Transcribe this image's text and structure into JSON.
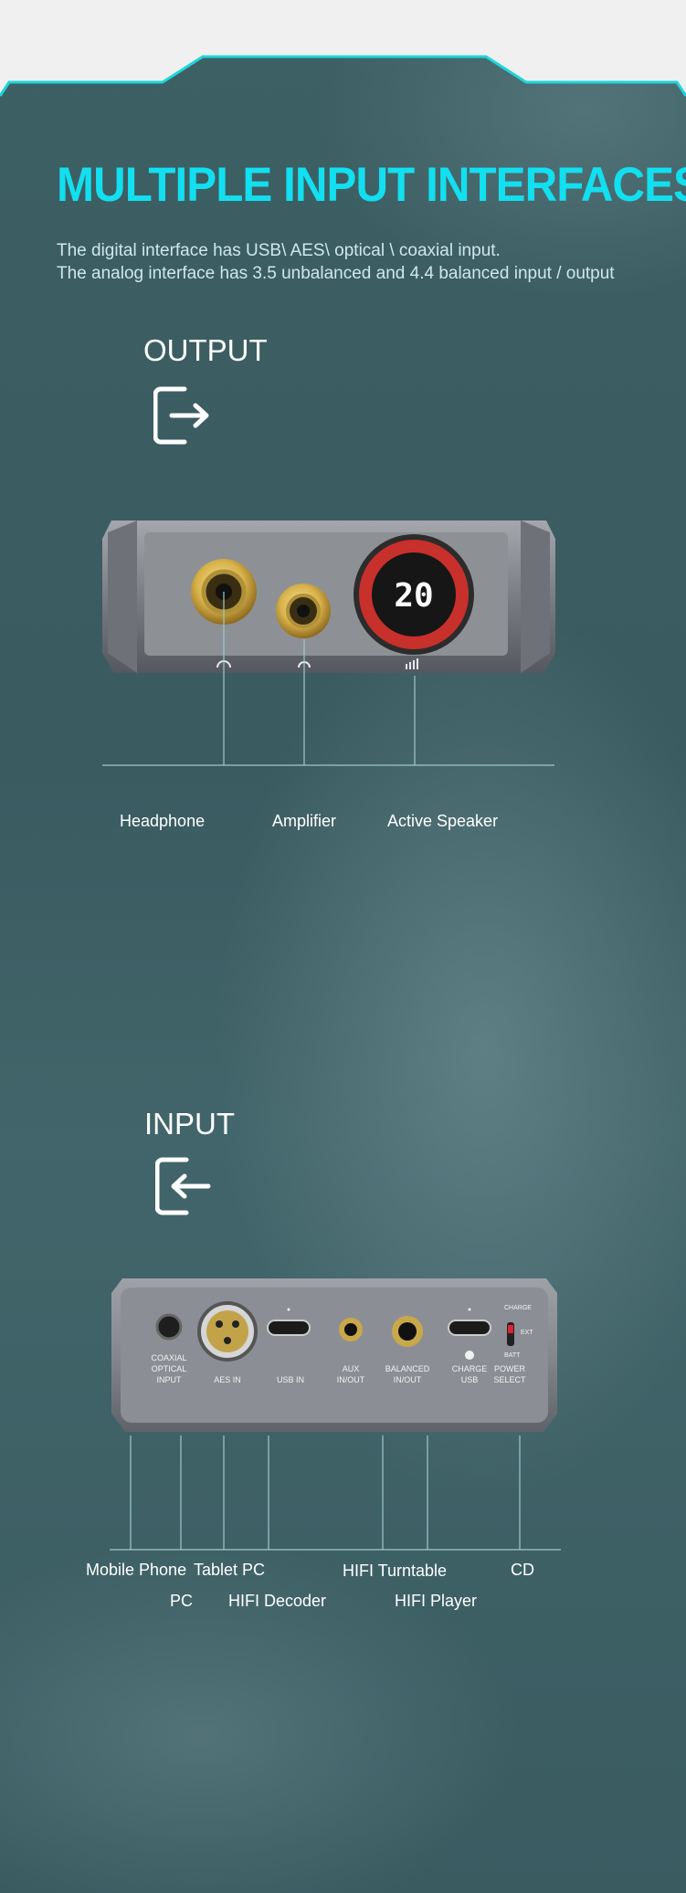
{
  "headline": "MULTIPLE INPUT INTERFACES",
  "description": [
    "The digital interface has USB\\ AES\\ optical \\ coaxial input.",
    "The analog interface has 3.5 unbalanced and 4.4 balanced input / output"
  ],
  "output": {
    "title": "OUTPUT",
    "icon": "exit-arrow-icon",
    "display_value": "20",
    "labels": [
      "Headphone",
      "Amplifier",
      "Active Speaker"
    ]
  },
  "input": {
    "title": "INPUT",
    "icon": "enter-arrow-icon",
    "panel_labels": {
      "coaxial": [
        "COAXIAL",
        "OPTICAL",
        "INPUT"
      ],
      "aes": "AES IN",
      "usb": "USB IN",
      "aux": [
        "AUX",
        "IN/OUT"
      ],
      "balanced": [
        "BALANCED",
        "IN/OUT"
      ],
      "charge": [
        "CHARGE",
        "USB"
      ],
      "power": [
        "POWER",
        "SELECT"
      ],
      "switch_charge": "CHARGE",
      "switch_ext": "EXT",
      "switch_batt": "BATT"
    },
    "labels_row1": [
      "Mobile Phone",
      "Tablet PC",
      "HIFI Turntable",
      "CD"
    ],
    "labels_row2": [
      "PC",
      "HIFI Decoder",
      "HIFI Player"
    ]
  },
  "colors": {
    "accent": "#12dff0",
    "background": "#3d6064",
    "knob_ring": "#c8302c",
    "gold": "#d8b24a"
  }
}
